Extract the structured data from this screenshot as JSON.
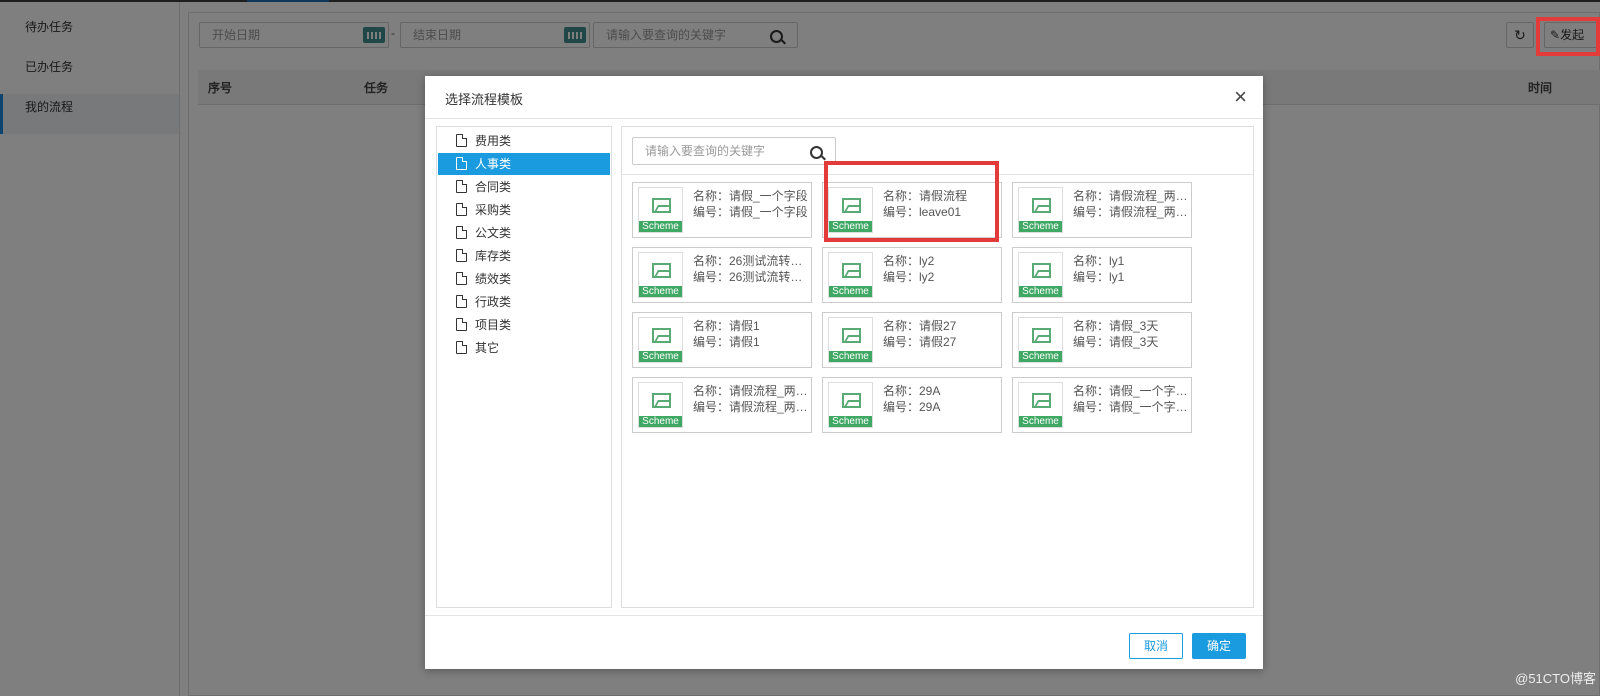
{
  "sidebar": {
    "items": [
      {
        "label": "待办任务"
      },
      {
        "label": "已办任务"
      },
      {
        "label": "我的流程"
      }
    ]
  },
  "toolbar": {
    "start_date_placeholder": "开始日期",
    "date_separator": "-",
    "end_date_placeholder": "结束日期",
    "search_placeholder": "请输入要查询的关键字",
    "launch_label": "发起"
  },
  "table": {
    "headers": [
      "序号",
      "任务",
      "时间"
    ]
  },
  "modal": {
    "title": "选择流程模板",
    "categories": [
      {
        "label": "费用类"
      },
      {
        "label": "人事类",
        "selected": true
      },
      {
        "label": "合同类"
      },
      {
        "label": "采购类"
      },
      {
        "label": "公文类"
      },
      {
        "label": "库存类"
      },
      {
        "label": "绩效类"
      },
      {
        "label": "行政类"
      },
      {
        "label": "项目类"
      },
      {
        "label": "其它"
      }
    ],
    "search_placeholder": "请输入要查询的关键字",
    "thumb_label": "Scheme",
    "templates": [
      {
        "name": "名称：请假_一个字段",
        "code": "编号：请假_一个字段"
      },
      {
        "name": "名称：请假流程",
        "code": "编号：leave01"
      },
      {
        "name": "名称：请假流程_两…",
        "code": "编号：请假流程_两…"
      },
      {
        "name": "名称：26测试流转…",
        "code": "编号：26测试流转…"
      },
      {
        "name": "名称：ly2",
        "code": "编号：ly2"
      },
      {
        "name": "名称：ly1",
        "code": "编号：ly1"
      },
      {
        "name": "名称：请假1",
        "code": "编号：请假1"
      },
      {
        "name": "名称：请假27",
        "code": "编号：请假27"
      },
      {
        "name": "名称：请假_3天",
        "code": "编号：请假_3天"
      },
      {
        "name": "名称：请假流程_两…",
        "code": "编号：请假流程_两…"
      },
      {
        "name": "名称：29A",
        "code": "编号：29A"
      },
      {
        "name": "名称：请假_一个字…",
        "code": "编号：请假_一个字…"
      }
    ],
    "cancel_label": "取消",
    "ok_label": "确定"
  },
  "watermark": "@51CTO博客",
  "colors": {
    "accent": "#1a9be0",
    "highlight": "#e33a3a",
    "scheme_green": "#3fa864"
  }
}
